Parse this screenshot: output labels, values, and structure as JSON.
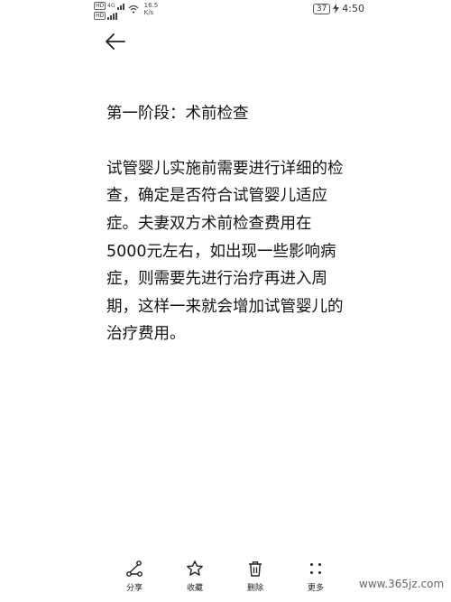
{
  "status_bar": {
    "hd_label": "HD",
    "network_label": "4G",
    "speed_value": "16.5",
    "speed_unit": "K/s",
    "battery": "37",
    "time": "4:50"
  },
  "article": {
    "heading": "第一阶段：术前检查",
    "body": "试管婴儿实施前需要进行详细的检查，确定是否符合试管婴儿适应症。夫妻双方术前检查费用在5000元左右，如出现一些影响病症，则需要先进行治疗再进入周期，这样一来就会增加试管婴儿的治疗费用。"
  },
  "actions": {
    "share": "分享",
    "favorite": "收藏",
    "delete": "删除",
    "more": "更多"
  },
  "watermark": "www.365jz.com"
}
